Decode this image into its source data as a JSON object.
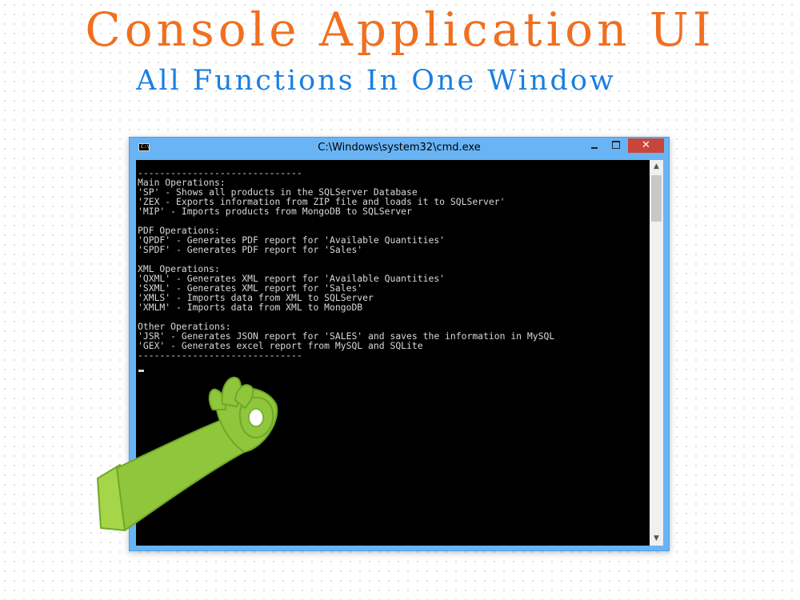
{
  "headline": "Console Application UI",
  "subheadline": "All Functions In One Window",
  "window": {
    "title": "C:\\Windows\\system32\\cmd.exe",
    "icon": "console-icon",
    "icon_label": "C:\\",
    "close_label": "✕"
  },
  "console": {
    "lines": [
      "------------------------------",
      "Main Operations:",
      "'SP' - Shows all products in the SQLServer Database",
      "'ZEX - Exports information from ZIP file and loads it to SQLServer'",
      "'MIP' - Imports products from MongoDB to SQLServer",
      "",
      "PDF Operations:",
      "'QPDF' - Generates PDF report for 'Available Quantities'",
      "'SPDF' - Generates PDF report for 'Sales'",
      "",
      "XML Operations:",
      "'QXML' - Generates XML report for 'Available Quantities'",
      "'SXML' - Generates XML report for 'Sales'",
      "'XMLS' - Imports data from XML to SQLServer",
      "'XMLM' - Imports data from XML to MongoDB",
      "",
      "Other Operations:",
      "'JSR' - Generates JSON report for 'SALES' and saves the information in MySQL",
      "'GEX' - Generates excel report from MySQL and SQLite",
      "------------------------------"
    ]
  },
  "decoration": {
    "hand_color": "#8fc63b",
    "hand_gesture": "ok-hand-sign"
  }
}
